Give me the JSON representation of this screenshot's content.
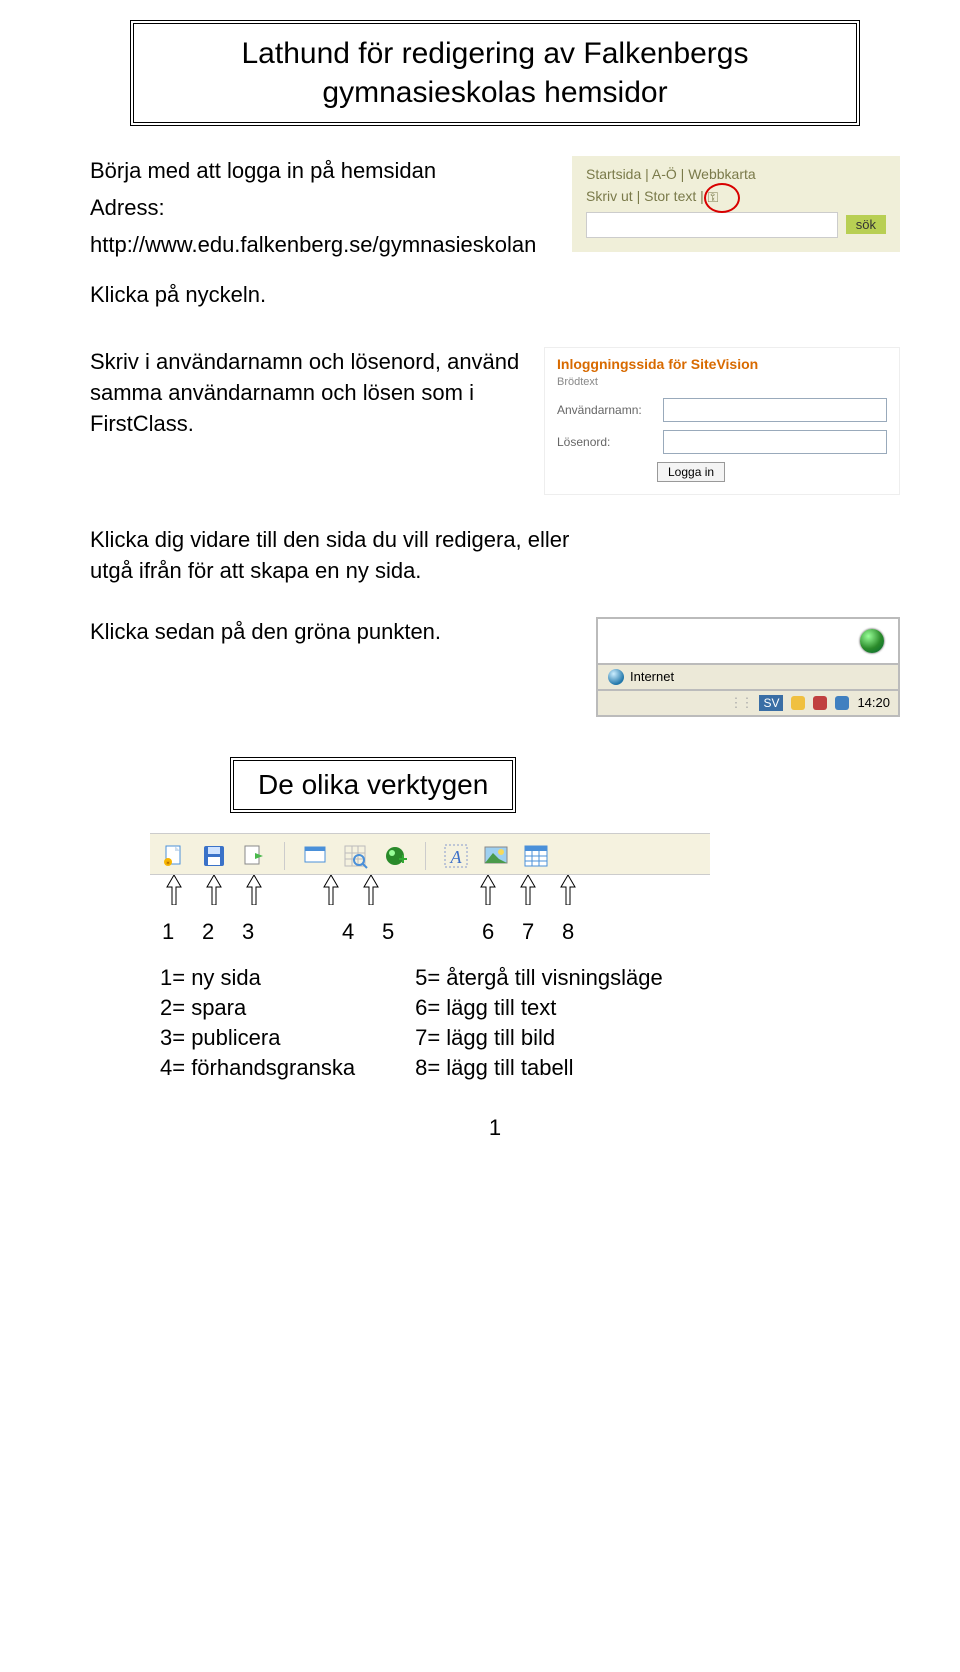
{
  "title": "Lathund för redigering av Falkenbergs gymnasieskolas hemsidor",
  "intro": {
    "line1": "Börja med att logga in på hemsidan",
    "line2": "Adress:",
    "line3": "http://www.edu.falkenberg.se/gymnasieskolan",
    "line4": "Klicka på nyckeln."
  },
  "shot1": {
    "nav1a": "Startsida",
    "nav1b": "A-Ö",
    "nav1c": "Webbkarta",
    "nav2a": "Skriv ut",
    "nav2b": "Stor text",
    "sok": "sök"
  },
  "para2": "Skriv i användarnamn och lösenord, använd samma användarnamn och lösen som i FirstClass.",
  "shot2": {
    "header": "Inloggningssida för SiteVision",
    "sub": "Brödtext",
    "user_label": "Användarnamn:",
    "pass_label": "Lösenord:",
    "login_btn": "Logga in"
  },
  "para3": "Klicka dig vidare till den sida du vill redigera, eller utgå ifrån för att skapa en ny sida.",
  "para4": "Klicka sedan på den gröna punkten.",
  "shot3": {
    "internet": "Internet",
    "lang": "SV",
    "time": "14:20"
  },
  "tools_header": "De olika verktygen",
  "numbers": {
    "n1": "1",
    "n2": "2",
    "n3": "3",
    "n4": "4",
    "n5": "5",
    "n6": "6",
    "n7": "7",
    "n8": "8"
  },
  "legend_left": {
    "l1": "1= ny sida",
    "l2": "2= spara",
    "l3": "3= publicera",
    "l4": "4= förhandsgranska"
  },
  "legend_right": {
    "r1": "5= återgå till visningsläge",
    "r2": "6= lägg till text",
    "r3": "7= lägg till bild",
    "r4": "8= lägg till tabell"
  },
  "page_number": "1"
}
